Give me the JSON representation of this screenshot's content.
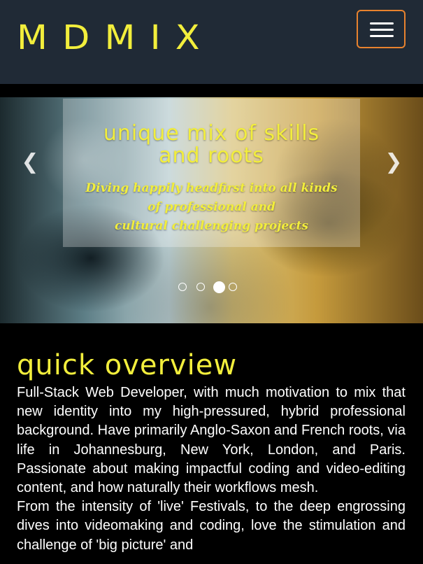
{
  "navbar": {
    "brand": "MDMIX",
    "menu_toggle_icon": "hamburger-icon"
  },
  "colors": {
    "accent_yellow": "#f2ee3c",
    "navbar_bg": "#202a36",
    "toggle_border": "#e8822e",
    "page_bg": "#000000"
  },
  "carousel": {
    "title": "unique mix of skills\nand roots",
    "subtitle": "Diving happily headfirst into all kinds\nof professional and\ncultural challenging projects",
    "prev_icon": "chevron-left-icon",
    "next_icon": "chevron-right-icon",
    "prev_glyph": "❮",
    "next_glyph": "❯",
    "slide_count": 4,
    "active_index": 2
  },
  "overview": {
    "title": "quick overview",
    "paragraphs": [
      "Full-Stack Web Developer, with much motivation to mix that new identity into my high-pressured, hybrid professional background. Have primarily Anglo-Saxon and French roots, via life in Johannesburg, New York, London, and Paris. Passionate about making impactful coding and video-editing content, and how naturally their workflows mesh.",
      "From the intensity of 'live' Festivals, to the deep engrossing dives into videomaking and coding, love the stimulation and challenge of 'big picture' and"
    ]
  }
}
